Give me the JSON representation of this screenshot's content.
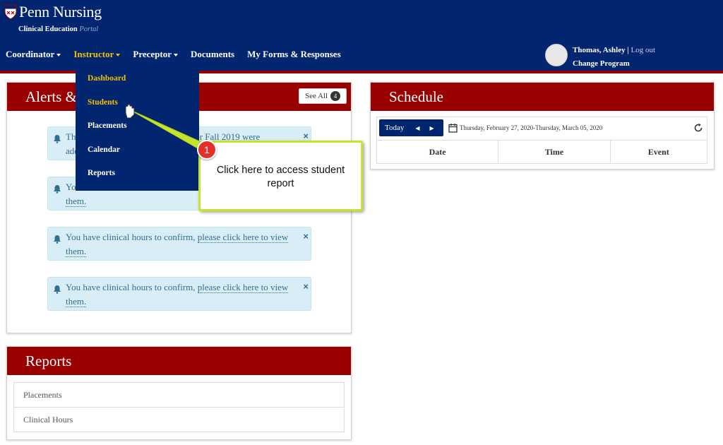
{
  "header": {
    "logo_text": "Penn Nursing",
    "logo_sub": "Clinical Education",
    "logo_sub_accent": "Portal"
  },
  "nav": {
    "coordinator": "Coordinator",
    "instructor": "Instructor",
    "preceptor": "Preceptor",
    "documents": "Documents",
    "forms": "My Forms & Responses"
  },
  "user": {
    "name": "Thomas, Ashley",
    "separator": "|",
    "logout": "Log out",
    "change_program": "Change Program"
  },
  "dropdown": {
    "items": [
      "Dashboard",
      "Students",
      "Placements",
      "Calendar",
      "Reports"
    ]
  },
  "alerts_panel": {
    "title": "Alerts &",
    "see_all": "See All",
    "count": "4",
    "alerts": [
      {
        "line1": "Th",
        "line1_end": "ers for Fall 2019 were",
        "line2": "ade"
      },
      {
        "line1": "Yo",
        "line2": "them."
      },
      {
        "text": "You have clinical hours to confirm, ",
        "link": "please click here to view",
        "line2": "them."
      },
      {
        "text": "You have clinical hours to confirm, ",
        "link": "please click here to view",
        "line2": "them."
      }
    ]
  },
  "reports_panel": {
    "title": "Reports",
    "items": [
      "Placements",
      "Clinical Hours"
    ]
  },
  "schedule": {
    "title": "Schedule",
    "today": "Today",
    "date_range": "Thursday, February 27, 2020-Thursday, March 05, 2020",
    "columns": [
      "Date",
      "Time",
      "Event"
    ]
  },
  "callout": {
    "step": "1",
    "text": "Click here to access student report",
    "color": "#c4e52a"
  },
  "colors": {
    "navy": "#01256e",
    "crimson": "#990000",
    "active_nav": "#f2c200"
  }
}
